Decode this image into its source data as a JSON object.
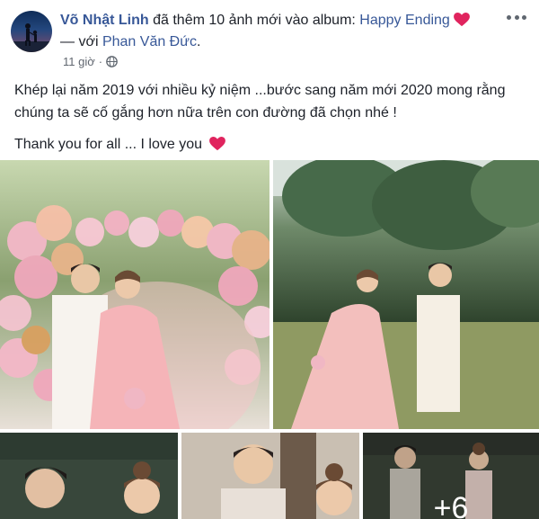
{
  "post": {
    "author": "Võ Nhật Linh",
    "action": "đã thêm 10 ảnh mới vào album:",
    "album": "Happy Ending",
    "with_prefix": "— với",
    "tagged": "Phan Văn Đức",
    "period": ".",
    "time": "11 giờ",
    "separator": "·",
    "privacy_icon": "globe-icon",
    "line1": "Khép lại năm 2019 với nhiều kỷ niệm ...bước sang năm mới 2020 mong rằng chúng ta sẽ cố gắng hơn nữa trên con đường đã chọn nhé !",
    "line2": "Thank you for all ... I love you",
    "heart_color": "#e0245e",
    "link_color": "#385898"
  },
  "photos": [
    {
      "name": "photo-balloon-couple",
      "icon": "photo"
    },
    {
      "name": "photo-forest-walk",
      "icon": "photo"
    },
    {
      "name": "photo-forest-couple-closeup",
      "icon": "photo"
    },
    {
      "name": "photo-smiling-couple",
      "icon": "photo"
    },
    {
      "name": "photo-couple-standing",
      "icon": "photo",
      "overlay_text": "+6"
    }
  ]
}
